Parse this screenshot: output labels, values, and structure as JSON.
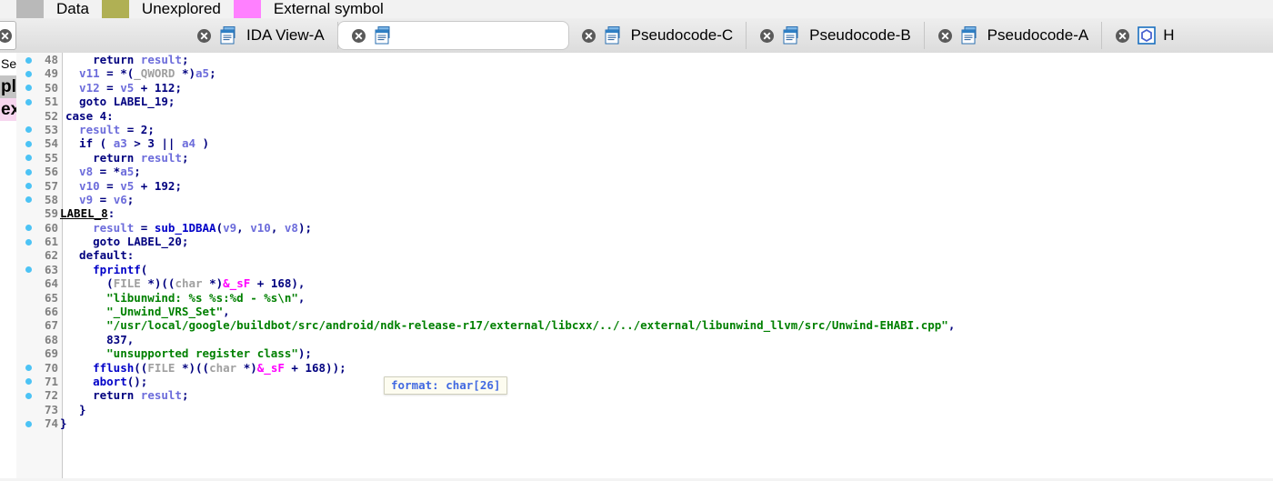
{
  "legend": {
    "items": [
      {
        "label": "Data",
        "swatch": "#b9b9b9"
      },
      {
        "label": "Unexplored",
        "swatch": "#b0b054"
      },
      {
        "label": "External symbol",
        "swatch": "#ff80ff"
      }
    ]
  },
  "tabs": [
    {
      "label": "IDA View-A",
      "icon": "document-icon",
      "active": false
    },
    {
      "label": "",
      "icon": "document-icon",
      "active": true
    },
    {
      "label": "Pseudocode-C",
      "icon": "document-icon",
      "active": false
    },
    {
      "label": "Pseudocode-B",
      "icon": "document-icon",
      "active": false
    },
    {
      "label": "Pseudocode-A",
      "icon": "document-icon",
      "active": false
    },
    {
      "label": "H",
      "icon": "hex-view-icon",
      "active": false
    }
  ],
  "side_panel": {
    "rows": [
      {
        "text": "Seg",
        "style": "seg"
      },
      {
        "text": "pl",
        "style": "gray"
      },
      {
        "text": "ex",
        "style": "pink"
      }
    ]
  },
  "tooltip": {
    "text": "format: char[26]"
  },
  "code": {
    "lines": [
      {
        "n": "48",
        "dot": true,
        "html": "<span class=\"kw\">    return </span><span class=\"var\">result</span><span class=\"kw\">;</span>"
      },
      {
        "n": "49",
        "dot": true,
        "html": "<span class=\"var\">  v11</span><span class=\"kw\"> = *(</span><span class=\"typ\">_QWORD </span><span class=\"kw\">*)</span><span class=\"var\">a5</span><span class=\"kw\">;</span>"
      },
      {
        "n": "50",
        "dot": true,
        "html": "<span class=\"var\">  v12</span><span class=\"kw\"> = </span><span class=\"var\">v5</span><span class=\"kw\"> + </span><span class=\"num\">112</span><span class=\"kw\">;</span>"
      },
      {
        "n": "51",
        "dot": true,
        "html": "<span class=\"kw\">  goto LABEL_19;</span>"
      },
      {
        "n": "52",
        "dot": false,
        "html": "<span class=\"kw\">case 4:</span>"
      },
      {
        "n": "53",
        "dot": true,
        "html": "<span class=\"var\">  result</span><span class=\"kw\"> = </span><span class=\"num\">2</span><span class=\"kw\">;</span>"
      },
      {
        "n": "54",
        "dot": true,
        "html": "<span class=\"kw\">  if ( </span><span class=\"var\">a3</span><span class=\"kw\"> &gt; </span><span class=\"num\">3</span><span class=\"kw\"> || </span><span class=\"var\">a4</span><span class=\"kw\"> )</span>"
      },
      {
        "n": "55",
        "dot": true,
        "html": "<span class=\"kw\">    return </span><span class=\"var\">result</span><span class=\"kw\">;</span>"
      },
      {
        "n": "56",
        "dot": true,
        "html": "<span class=\"var\">  v8</span><span class=\"kw\"> = *</span><span class=\"var\">a5</span><span class=\"kw\">;</span>"
      },
      {
        "n": "57",
        "dot": true,
        "html": "<span class=\"var\">  v10</span><span class=\"kw\"> = </span><span class=\"var\">v5</span><span class=\"kw\"> + </span><span class=\"num\">192</span><span class=\"kw\">;</span>"
      },
      {
        "n": "58",
        "dot": true,
        "html": "<span class=\"var\">  v9</span><span class=\"kw\"> = </span><span class=\"var\">v6</span><span class=\"kw\">;</span>"
      },
      {
        "n": "59",
        "dot": false,
        "html": "<span class=\"lbl2\">LABEL_8</span><span class=\"kw\">:</span>",
        "nogutter": true
      },
      {
        "n": "60",
        "dot": true,
        "html": "<span class=\"var\">    result</span><span class=\"kw\"> = </span><span class=\"fn\">sub_1DBAA</span><span class=\"kw\">(</span><span class=\"var\">v9</span><span class=\"kw\">, </span><span class=\"var\">v10</span><span class=\"kw\">, </span><span class=\"var\">v8</span><span class=\"kw\">);</span>"
      },
      {
        "n": "61",
        "dot": true,
        "html": "<span class=\"kw\">    goto LABEL_20;</span>"
      },
      {
        "n": "62",
        "dot": false,
        "html": "<span class=\"kw\">  default:</span>"
      },
      {
        "n": "63",
        "dot": true,
        "html": "<span class=\"fn\">    fprintf</span><span class=\"kw\">(</span>"
      },
      {
        "n": "64",
        "dot": false,
        "html": "<span class=\"kw\">      (</span><span class=\"typ\">FILE </span><span class=\"kw\">*)((</span><span class=\"typ\">char </span><span class=\"kw\">*)</span><span class=\"ext\">&amp;_sF</span><span class=\"kw\"> + </span><span class=\"num\">168</span><span class=\"kw\">),</span>"
      },
      {
        "n": "65",
        "dot": false,
        "html": "<span class=\"str\">      \"libunwind: %s %s:%d - %s\\n\"</span><span class=\"kw\">,</span>"
      },
      {
        "n": "66",
        "dot": false,
        "html": "<span class=\"str\">      \"_Unwind_VRS_Set\"</span><span class=\"kw\">,</span>"
      },
      {
        "n": "67",
        "dot": false,
        "html": "<span class=\"str\">      \"/usr/local/google/buildbot/src/android/ndk-release-r17/external/libcxx/../../external/libunwind_llvm/src/Unwind-EHABI.cpp\"</span><span class=\"kw\">,</span>"
      },
      {
        "n": "68",
        "dot": false,
        "html": "<span class=\"num\">      837</span><span class=\"kw\">,</span>"
      },
      {
        "n": "69",
        "dot": false,
        "html": "<span class=\"str\">      \"unsupported register class\"</span><span class=\"kw\">);</span>"
      },
      {
        "n": "70",
        "dot": true,
        "html": "<span class=\"fn\">    fflush</span><span class=\"kw\">((</span><span class=\"typ\">FILE </span><span class=\"kw\">*)((</span><span class=\"typ\">char </span><span class=\"kw\">*)</span><span class=\"ext\">&amp;_sF</span><span class=\"kw\"> + </span><span class=\"num\">168</span><span class=\"kw\">));</span>"
      },
      {
        "n": "71",
        "dot": true,
        "html": "<span class=\"fn\">    abort</span><span class=\"kw\">();</span>"
      },
      {
        "n": "72",
        "dot": true,
        "html": "<span class=\"kw\">    return </span><span class=\"var\">result</span><span class=\"kw\">;</span>"
      },
      {
        "n": "73",
        "dot": false,
        "html": "<span class=\"kw\">  }</span>"
      },
      {
        "n": "74",
        "dot": true,
        "html": "<span class=\"kw\">}</span>",
        "nogutter": true
      }
    ]
  }
}
